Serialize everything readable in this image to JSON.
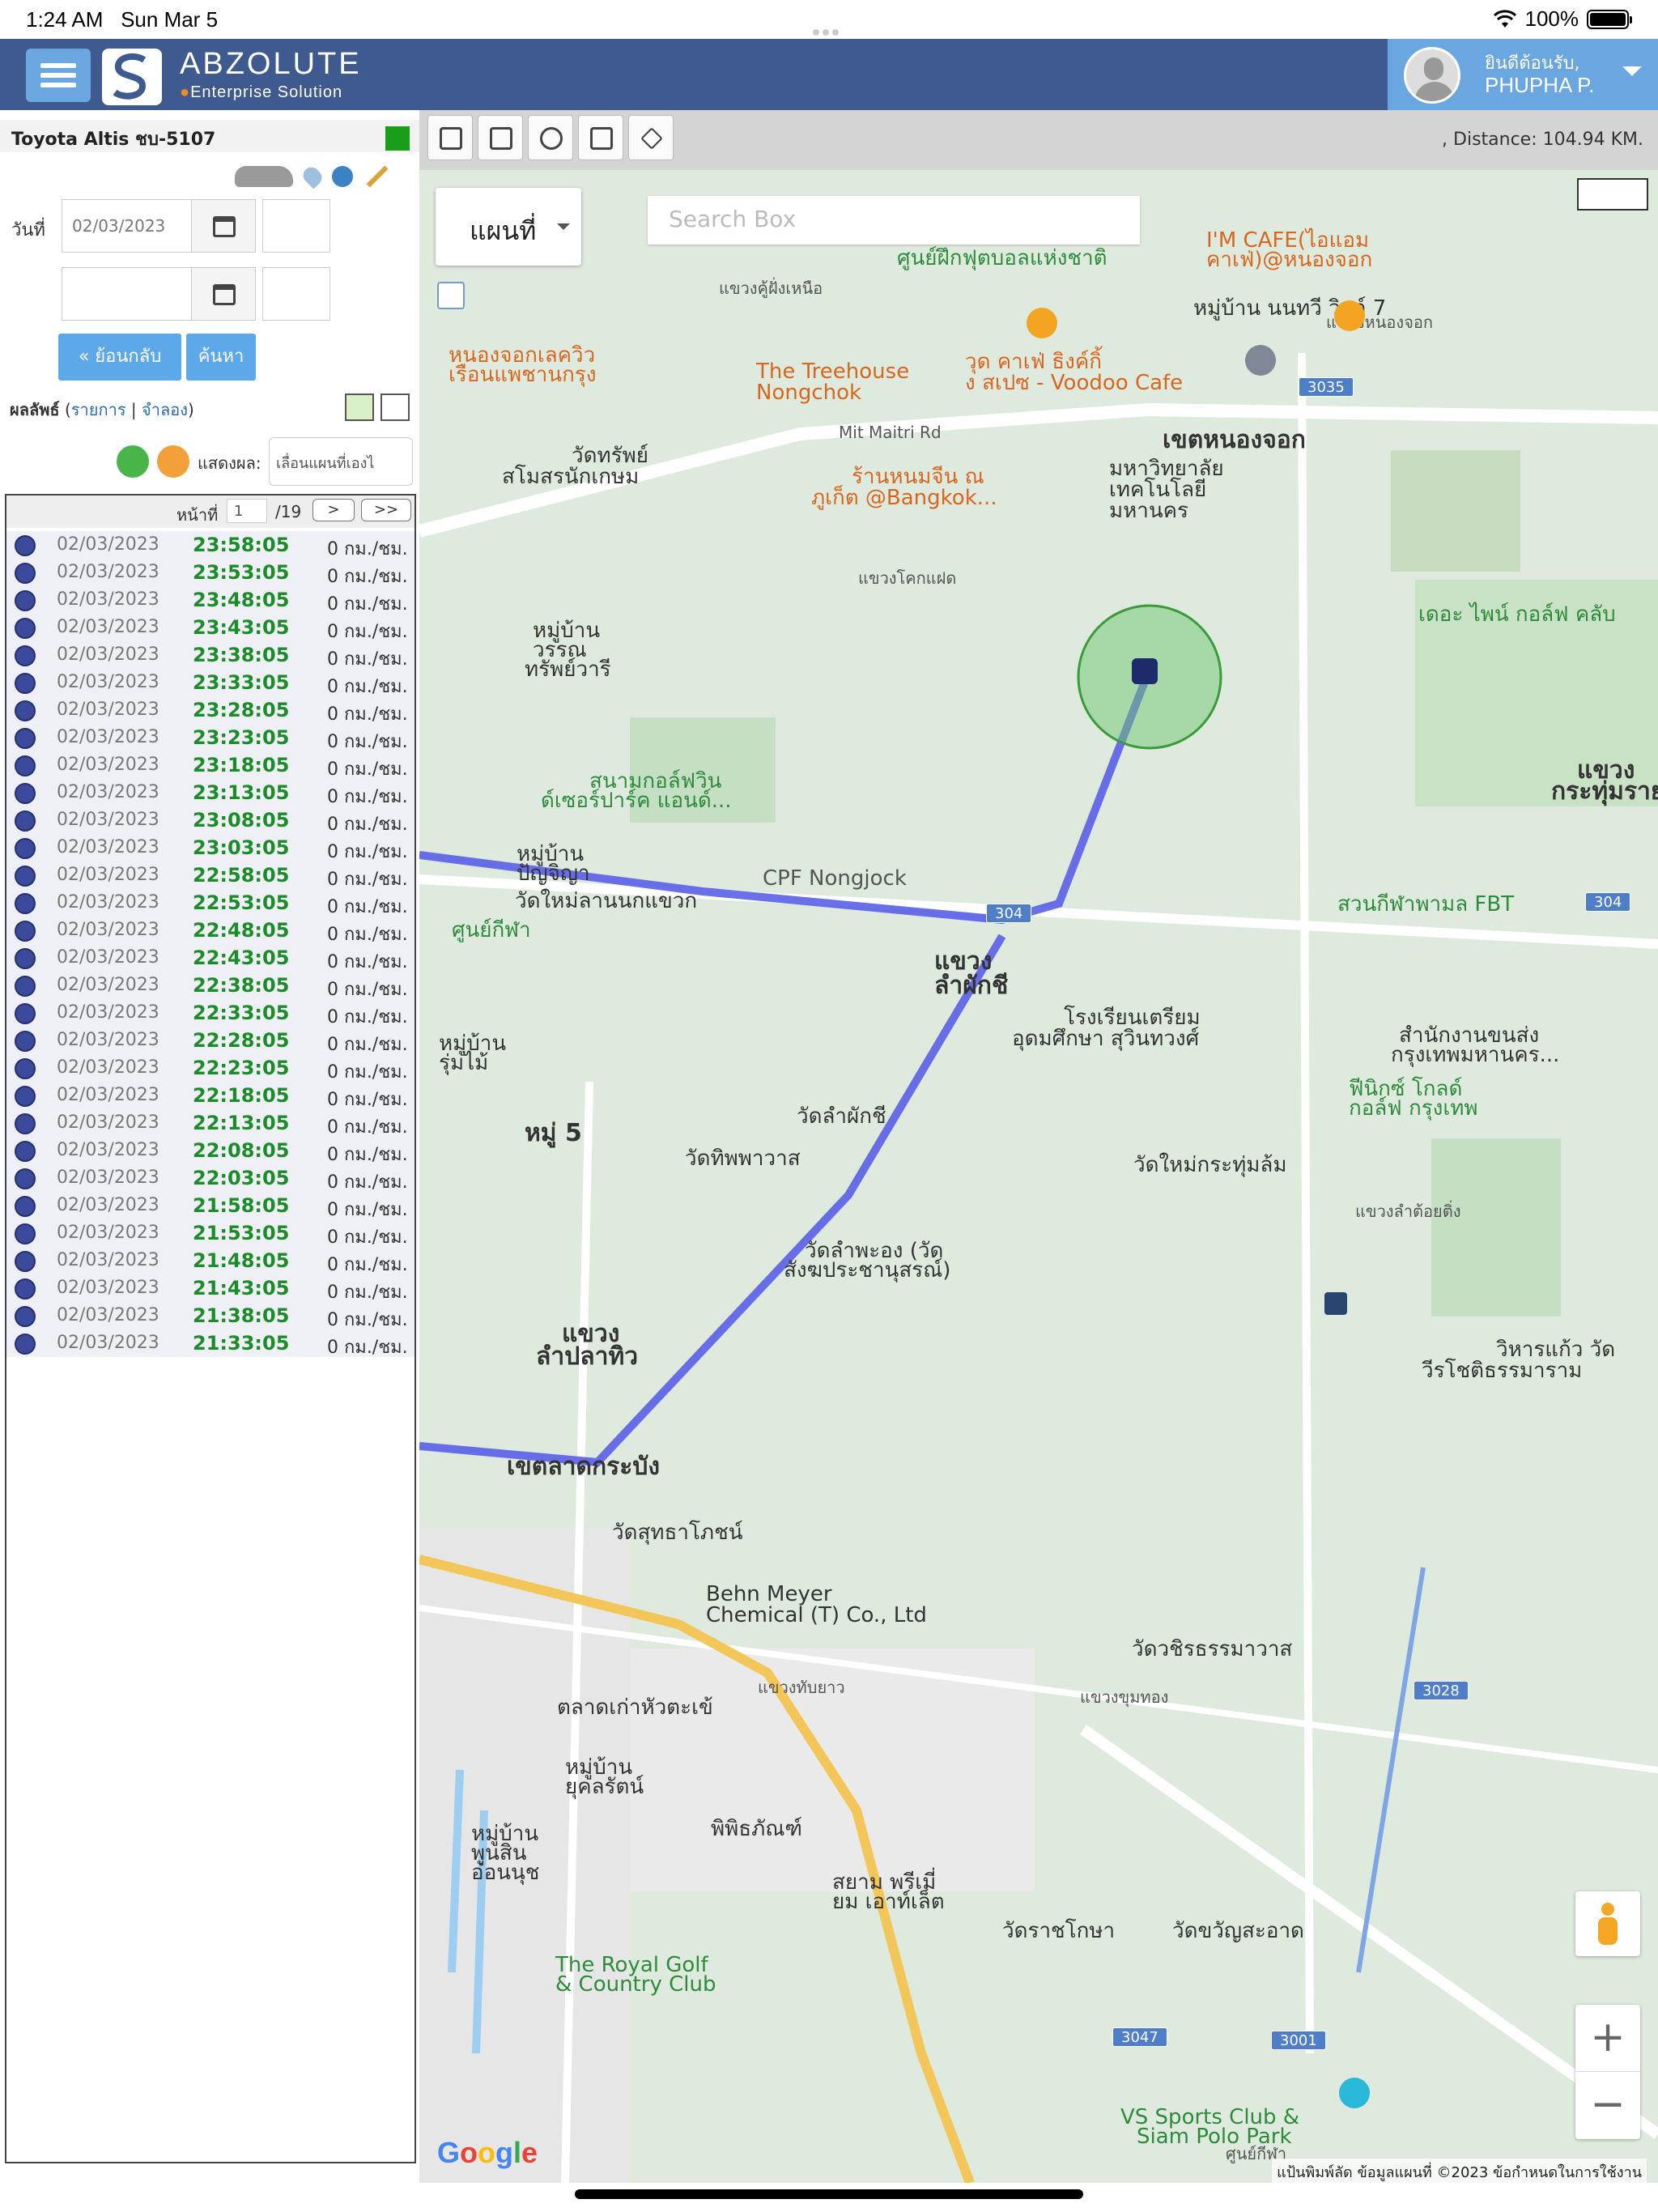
{
  "status_bar": {
    "time": "1:24 AM",
    "date": "Sun Mar 5",
    "battery": "100%"
  },
  "header": {
    "brand_name": "ABZOLUTE",
    "brand_tagline": "Enterprise Solution",
    "greeting": "ยินดีต้อนรับ,",
    "user_name": "PHUPHA P."
  },
  "left_panel": {
    "vehicle_name": "Toyota Altis ชบ-5107",
    "date_label": "วันที่",
    "date_from": "02/03/2023",
    "date_to": "",
    "back_button": "« ย้อนกลับ",
    "search_button": "ค้นหา",
    "results_label": "ผลลัพธ์",
    "results_list_link": "รายการ",
    "results_sim_link": "จำลอง",
    "show_label": "แสดงผล:",
    "show_select": "เลื่อนแผนที่เองไ",
    "pager": {
      "label": "หน้าที่",
      "page": "1",
      "total": "/19",
      "next": ">",
      "last": ">>"
    },
    "rows": [
      {
        "date": "02/03/2023",
        "time": "23:58:05",
        "speed": "0 กม./ชม."
      },
      {
        "date": "02/03/2023",
        "time": "23:53:05",
        "speed": "0 กม./ชม."
      },
      {
        "date": "02/03/2023",
        "time": "23:48:05",
        "speed": "0 กม./ชม."
      },
      {
        "date": "02/03/2023",
        "time": "23:43:05",
        "speed": "0 กม./ชม."
      },
      {
        "date": "02/03/2023",
        "time": "23:38:05",
        "speed": "0 กม./ชม."
      },
      {
        "date": "02/03/2023",
        "time": "23:33:05",
        "speed": "0 กม./ชม."
      },
      {
        "date": "02/03/2023",
        "time": "23:28:05",
        "speed": "0 กม./ชม."
      },
      {
        "date": "02/03/2023",
        "time": "23:23:05",
        "speed": "0 กม./ชม."
      },
      {
        "date": "02/03/2023",
        "time": "23:18:05",
        "speed": "0 กม./ชม."
      },
      {
        "date": "02/03/2023",
        "time": "23:13:05",
        "speed": "0 กม./ชม."
      },
      {
        "date": "02/03/2023",
        "time": "23:08:05",
        "speed": "0 กม./ชม."
      },
      {
        "date": "02/03/2023",
        "time": "23:03:05",
        "speed": "0 กม./ชม."
      },
      {
        "date": "02/03/2023",
        "time": "22:58:05",
        "speed": "0 กม./ชม."
      },
      {
        "date": "02/03/2023",
        "time": "22:53:05",
        "speed": "0 กม./ชม."
      },
      {
        "date": "02/03/2023",
        "time": "22:48:05",
        "speed": "0 กม./ชม."
      },
      {
        "date": "02/03/2023",
        "time": "22:43:05",
        "speed": "0 กม./ชม."
      },
      {
        "date": "02/03/2023",
        "time": "22:38:05",
        "speed": "0 กม./ชม."
      },
      {
        "date": "02/03/2023",
        "time": "22:33:05",
        "speed": "0 กม./ชม."
      },
      {
        "date": "02/03/2023",
        "time": "22:28:05",
        "speed": "0 กม./ชม."
      },
      {
        "date": "02/03/2023",
        "time": "22:23:05",
        "speed": "0 กม./ชม."
      },
      {
        "date": "02/03/2023",
        "time": "22:18:05",
        "speed": "0 กม./ชม."
      },
      {
        "date": "02/03/2023",
        "time": "22:13:05",
        "speed": "0 กม./ชม."
      },
      {
        "date": "02/03/2023",
        "time": "22:08:05",
        "speed": "0 กม./ชม."
      },
      {
        "date": "02/03/2023",
        "time": "22:03:05",
        "speed": "0 กม./ชม."
      },
      {
        "date": "02/03/2023",
        "time": "21:58:05",
        "speed": "0 กม./ชม."
      },
      {
        "date": "02/03/2023",
        "time": "21:53:05",
        "speed": "0 กม./ชม."
      },
      {
        "date": "02/03/2023",
        "time": "21:48:05",
        "speed": "0 กม./ชม."
      },
      {
        "date": "02/03/2023",
        "time": "21:43:05",
        "speed": "0 กม./ชม."
      },
      {
        "date": "02/03/2023",
        "time": "21:38:05",
        "speed": "0 กม./ชม."
      },
      {
        "date": "02/03/2023",
        "time": "21:33:05",
        "speed": "0 กม./ชม."
      }
    ]
  },
  "map": {
    "distance": ", Distance: 104.94 KM.",
    "map_type": "แผนที่",
    "search_placeholder": "Search Box",
    "labels": [
      "ศูนย์ฝึกฟุตบอลแห่งชาติ",
      "I'M CAFE(ไอแอม",
      "คาเฟ่)@หนองจอก",
      "แขวงคู้ฝั่งเหนือ",
      "หมู่บ้าน นนทวี วิลล์ 7",
      "แขวงหนองจอก",
      "หนองจอกเลควิว",
      "เรือนแพชานกรุง",
      "The Treehouse",
      "Nongchok",
      "วุด คาเฟ่ ธิงค์กิ้",
      "ง สเปซ - Voodoo Cafe",
      "Mit Maitri Rd",
      "เขตหนองจอก",
      "วัดทรัพย์",
      "สโมสรนักเกษม",
      "ร้านหนมจีน ณ",
      "ภูเก็ต @Bangkok...",
      "มหาวิทยาลัย",
      "เทคโนโลยี",
      "มหานคร",
      "แขวงโคกแฝด",
      "หมู่บ้าน",
      "วรรณ",
      "ทรัพย์วารี",
      "เดอะ ไพน์ กอล์ฟ คลับ",
      "แขวง",
      "กระทุ่มราย",
      "สนามกอล์ฟวิน",
      "ด์เซอร์ปาร์ค แอนด์...",
      "หมู่บ้าน",
      "ปัญจิญา",
      "CPF Nongjock",
      "วัดใหม่ลานนกแขวก",
      "สวนกีฬาพามล FBT",
      "ศูนย์กีฬา",
      "ลำผักชี",
      "แขวง",
      "โรงเรียนเตรียม",
      "อุดมศึกษา สุวินทวงศ์",
      "สำนักงานขนส่ง",
      "กรุงเทพมหานคร...",
      "หมู่บ้าน",
      "รุ่มไม้",
      "ฟีนิกซ์ โกลด์",
      "กอล์ฟ กรุงเทพ",
      "หมู่ 5",
      "วัดลำผักชี",
      "วัดทิพพาวาส",
      "วัดใหม่กระทุ่มล้ม",
      "แขวงลำต้อยติ่ง",
      "วัดลำพะอง (วัด",
      "สังฆประชานุสรณ์)",
      "แขวง",
      "ลำปลาทิว",
      "วิหารแก้ว วัด",
      "วีรโชติธรรมาราม",
      "เขตลาดกระบัง",
      "วัดสุทธาโภชน์",
      "Behn Meyer",
      "Chemical (T) Co., Ltd",
      "วัดวชิรธรรมาวาส",
      "แขวงทับยาว",
      "แขวงขุมทอง",
      "ตลาดเก่าหัวตะเข้",
      "หมู่บ้าน",
      "ยุคลรัตน์",
      "หมู่บ้าน",
      "พูนสิน",
      "อ่อนนุช",
      "พิพิธภัณฑ์",
      "สยาม พรีเมี่",
      "ยม เอาท์เล็ต",
      "วัดราชโกษา",
      "วัดขวัญสะอาด",
      "The Royal Golf",
      "& Country Club",
      "VS Sports Club &",
      "Siam Polo Park",
      "ศูนย์กีฬา"
    ],
    "shields": [
      "3035",
      "304",
      "304",
      "3028",
      "3047",
      "3001"
    ],
    "google_logo": "Google",
    "attribution": "แป้นพิมพ์ลัด   ข้อมูลแผนที่ ©2023   ข้อกำหนดในการใช้งาน",
    "zoom_in": "+",
    "zoom_out": "−"
  }
}
